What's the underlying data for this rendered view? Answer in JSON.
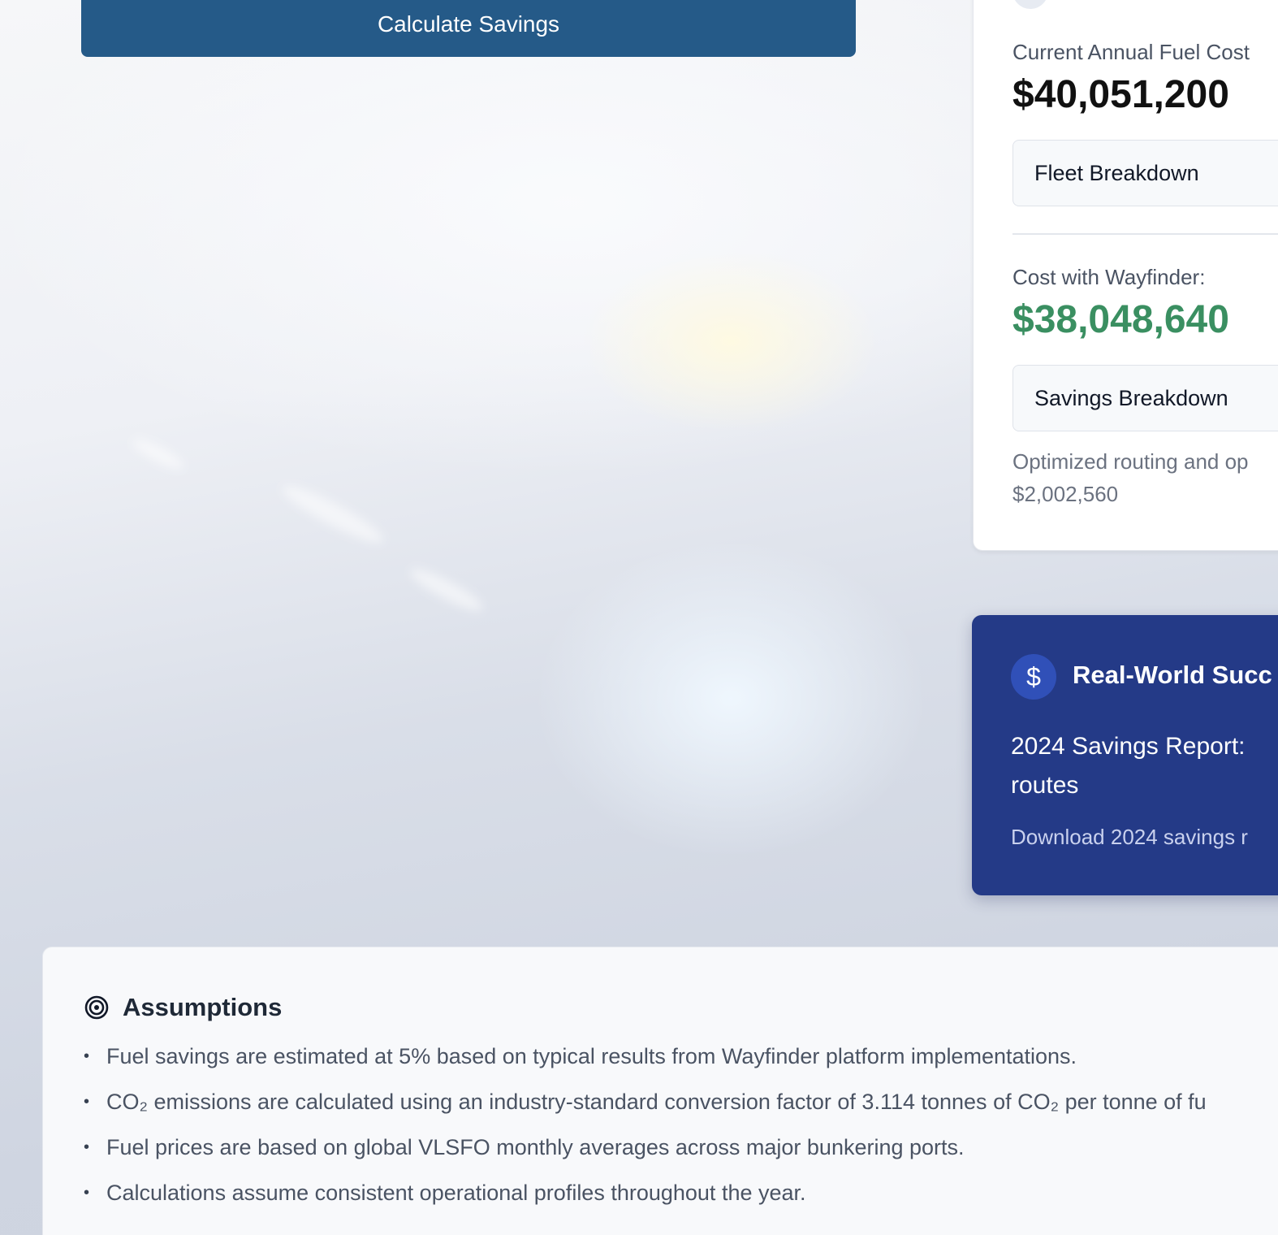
{
  "calculator": {
    "calculate_button": "Calculate Savings"
  },
  "results": {
    "current_cost_label": "Current Annual Fuel Cost",
    "current_cost_value": "$40,051,200",
    "fleet_breakdown_label": "Fleet Breakdown",
    "wayfinder_cost_label": "Cost with Wayfinder:",
    "wayfinder_cost_value": "$38,048,640",
    "savings_breakdown_label": "Savings Breakdown",
    "note_line1": "Optimized routing and op",
    "note_line2": "$2,002,560",
    "colors": {
      "savings_value": "#3a8f61",
      "current_value": "#111111"
    }
  },
  "success": {
    "icon": "dollar-icon",
    "title": "Real-World Succ",
    "text": "2024 Savings Report: routes",
    "link": "Download 2024 savings r",
    "colors": {
      "background": "#243a87",
      "icon_bg": "#3050b8"
    }
  },
  "assumptions": {
    "icon": "target-icon",
    "title": "Assumptions",
    "items": [
      "Fuel savings are estimated at 5% based on typical results from Wayfinder platform implementations.",
      "CO₂ emissions are calculated using an industry-standard conversion factor of 3.114 tonnes of CO₂ per tonne of fu",
      "Fuel prices are based on global VLSFO monthly averages across major bunkering ports.",
      "Calculations assume consistent operational profiles throughout the year."
    ]
  },
  "theme": {
    "primary_button": "#255a88",
    "text_muted": "#4a5363"
  }
}
